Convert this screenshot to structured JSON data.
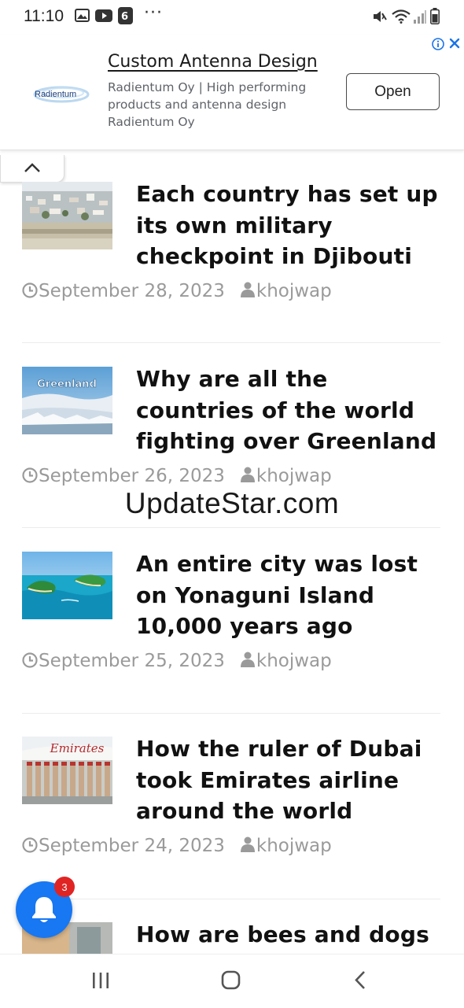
{
  "status_bar": {
    "time": "11:10",
    "more_dots": "···",
    "icons": [
      "gallery-icon",
      "youtube-icon",
      "app-icon",
      "mute-icon",
      "wifi-icon",
      "signal-icon",
      "battery-icon"
    ]
  },
  "ad": {
    "logo_text": "Radientum",
    "title": "Custom Antenna Design",
    "description": "Radientum Oy | High performing products and antenna design Radientum Oy",
    "button_label": "Open",
    "accent_color": "#1a73e8"
  },
  "articles": [
    {
      "title": "Each country has set up its own military checkpoint in Djibouti",
      "date": "September 28, 2023",
      "author": "khojwap"
    },
    {
      "title": "Why are all the countries of the world fighting over Greenland",
      "date": "September 26, 2023",
      "author": "khojwap",
      "thumb_text": "Greenland"
    },
    {
      "title": "An entire city was lost on Yonaguni Island 10,000 years ago",
      "date": "September 25, 2023",
      "author": "khojwap"
    },
    {
      "title": "How the ruler of Dubai took Emirates airline around the world",
      "date": "September 24, 2023",
      "author": "khojwap",
      "thumb_text": "Emirates"
    },
    {
      "title": "How are bees and dogs"
    }
  ],
  "watermark": "UpdateStar.com",
  "notification": {
    "badge_count": "3",
    "color": "#1877f2"
  }
}
